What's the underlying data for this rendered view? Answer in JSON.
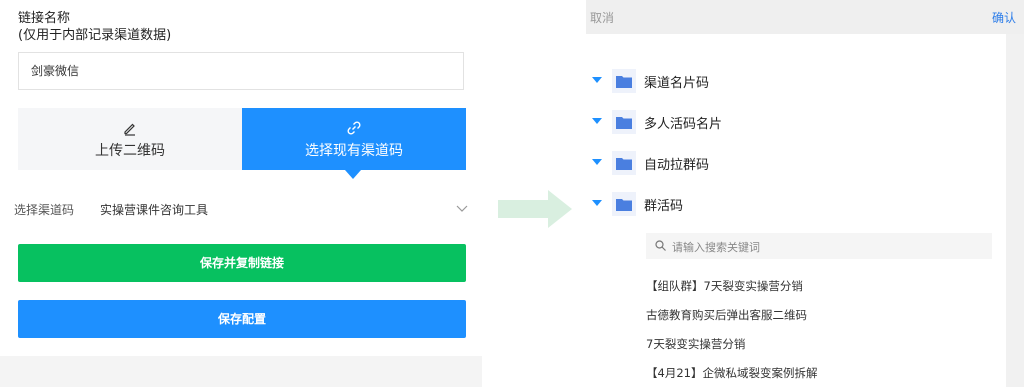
{
  "form": {
    "name_label": "链接名称",
    "name_hint": "(仅用于内部记录渠道数据)",
    "name_value": "剑豪微信",
    "tabs": [
      {
        "label": "上传二维码",
        "icon": "pen-icon",
        "active": false
      },
      {
        "label": "选择现有渠道码",
        "icon": "link-icon",
        "active": true
      }
    ],
    "select_label": "选择渠道码",
    "select_value": "实操营课件咨询工具",
    "save_copy_label": "保存并复制链接",
    "save_config_label": "保存配置"
  },
  "colors": {
    "primary": "#1e90ff",
    "green": "#07c160",
    "arrow": "#d9efe0",
    "link": "#2b7ce9"
  },
  "picker": {
    "cancel_label": "取消",
    "confirm_label": "确认",
    "folders": [
      {
        "label": "渠道名片码",
        "expanded": true
      },
      {
        "label": "多人活码名片",
        "expanded": true
      },
      {
        "label": "自动拉群码",
        "expanded": true
      },
      {
        "label": "群活码",
        "expanded": true
      }
    ],
    "search_placeholder": "请输入搜索关键词",
    "groups": [
      "【组队群】7天裂变实操营分销",
      "古德教育购买后弹出客服二维码",
      "7天裂变实操营分销",
      "【4月21】企微私域裂变案例拆解"
    ]
  }
}
